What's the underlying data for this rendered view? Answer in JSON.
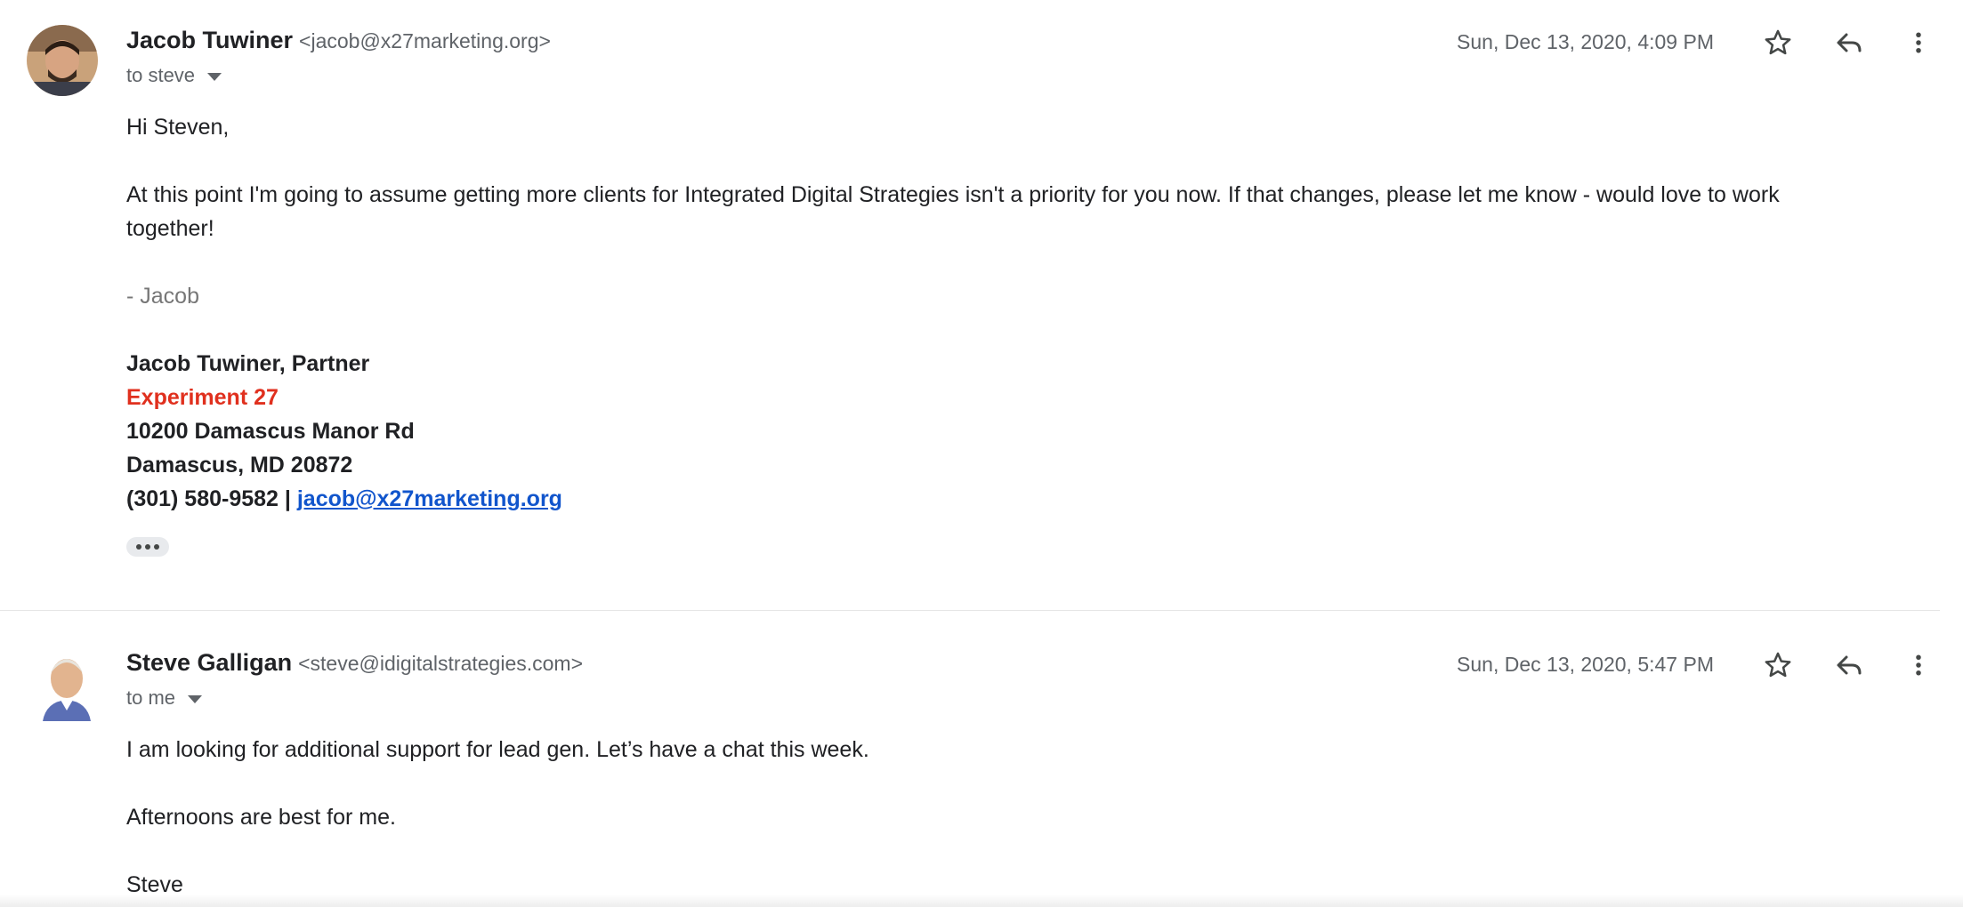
{
  "messages": [
    {
      "sender_name": "Jacob Tuwiner",
      "sender_email": "<jacob@x27marketing.org>",
      "recipient": "to steve",
      "date": "Sun, Dec 13, 2020, 4:09 PM",
      "body": {
        "greeting": "Hi Steven,",
        "paragraph": "At this point I'm going to assume getting more clients for Integrated Digital Strategies isn't a priority for you now. If that changes, please let me know - would love to work together!",
        "signoff": "- Jacob",
        "sig_name": "Jacob Tuwiner, Partner",
        "sig_company": "Experiment 27",
        "sig_address1": "10200 Damascus Manor Rd",
        "sig_address2": "Damascus, MD 20872",
        "sig_phone": "(301) 580-9582 | ",
        "sig_email": "jacob@x27marketing.org"
      }
    },
    {
      "sender_name": "Steve Galligan",
      "sender_email": "<steve@idigitalstrategies.com>",
      "recipient": "to me",
      "date": "Sun, Dec 13, 2020, 5:47 PM",
      "body": {
        "line1": "I am looking for additional support for lead gen. Let’s have a chat this week.",
        "line2": "Afternoons are best for me.",
        "line3": "Steve"
      }
    }
  ],
  "icons": {
    "star": "star-icon",
    "reply": "reply-icon",
    "more": "more-vert-icon",
    "trimmed": "trimmed-content-icon"
  },
  "colors": {
    "link": "#1155cc",
    "company": "#e0301e",
    "muted_text": "#5f6368"
  }
}
